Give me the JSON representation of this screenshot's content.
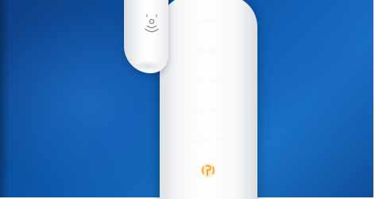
{
  "scene": {
    "description_colors": {
      "background_blue": "#0b58ab",
      "brush_white": "#ffffff",
      "logo_orange": "#f5a623"
    }
  },
  "brush": {
    "modes": [
      {
        "label": "clean"
      },
      {
        "label": "white+"
      },
      {
        "label": "gum health"
      },
      {
        "label": "deep clean+"
      },
      {
        "label": "tongue care"
      }
    ],
    "head_icon": "brushhead-sync-icon",
    "logo_icon": "smart-sensor-logo-icon"
  }
}
